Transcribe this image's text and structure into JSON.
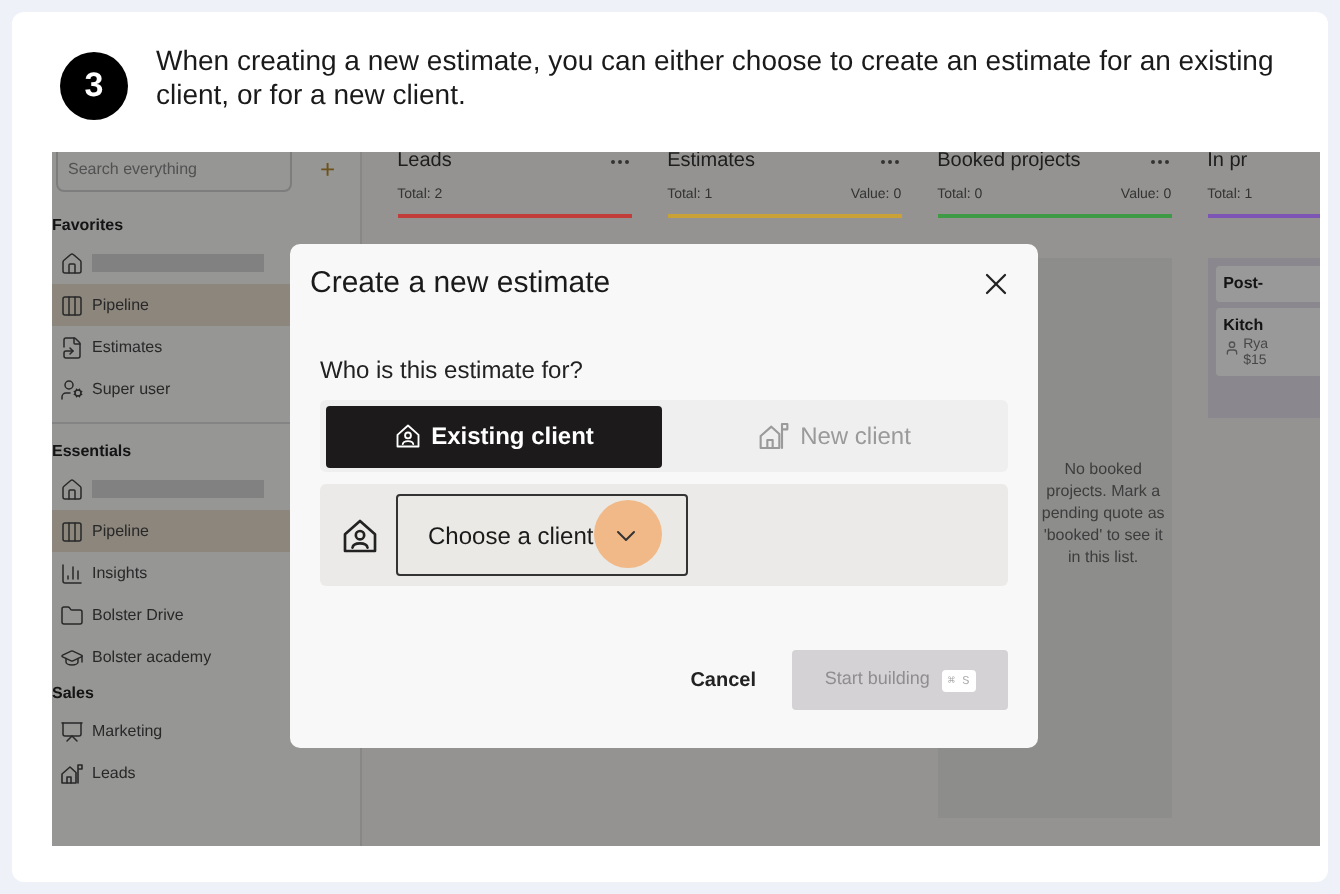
{
  "step": {
    "number": "3",
    "text": "When creating a new estimate, you can either choose to create an estimate for an existing client, or for a new client."
  },
  "sidebar": {
    "search_placeholder": "Search everything",
    "add_button": "+",
    "sections": [
      {
        "title": "Favorites",
        "items": [
          {
            "kind": "redacted",
            "selected": false
          },
          {
            "kind": "link",
            "label": "Pipeline",
            "selected": true
          },
          {
            "kind": "link",
            "label": "Estimates",
            "selected": false
          },
          {
            "kind": "link",
            "label": "Super user",
            "selected": false
          }
        ]
      },
      {
        "title": "Essentials",
        "items": [
          {
            "kind": "redacted",
            "selected": false
          },
          {
            "kind": "link",
            "label": "Pipeline",
            "selected": true
          },
          {
            "kind": "link",
            "label": "Insights",
            "selected": false
          },
          {
            "kind": "link",
            "label": "Bolster Drive",
            "selected": false
          },
          {
            "kind": "link",
            "label": "Bolster academy",
            "selected": false
          }
        ]
      },
      {
        "title": "Sales",
        "items": [
          {
            "kind": "link",
            "label": "Marketing",
            "selected": false
          },
          {
            "kind": "link",
            "label": "Leads",
            "selected": false
          }
        ]
      }
    ]
  },
  "columns": [
    {
      "title": "Leads",
      "total": "Total: 2",
      "color": "#c23d39"
    },
    {
      "title": "Estimates",
      "total": "Total: 1",
      "value": "Value: 0",
      "color": "#c9a237"
    },
    {
      "title": "Booked projects",
      "total": "Total: 0",
      "value": "Value: 0",
      "color": "#3f9a45",
      "empty_text": "No booked projects. Mark a pending quote as 'booked' to see it in this list."
    },
    {
      "title": "In pr",
      "total": "Total: 1",
      "color": "#7d55b5",
      "cards": [
        {
          "title": "Post-"
        },
        {
          "title": "Kitch",
          "client": "Rya",
          "amount": "$15"
        }
      ]
    }
  ],
  "modal": {
    "title": "Create a new estimate",
    "question": "Who is this estimate for?",
    "options": [
      {
        "label": "Existing client",
        "selected": true
      },
      {
        "label": "New client",
        "selected": false
      }
    ],
    "client_select": {
      "placeholder": "Choose a client",
      "click_highlight": true
    },
    "cancel": "Cancel",
    "submit": {
      "label": "Start building",
      "disabled": true,
      "shortcut": "⌘ S"
    }
  }
}
